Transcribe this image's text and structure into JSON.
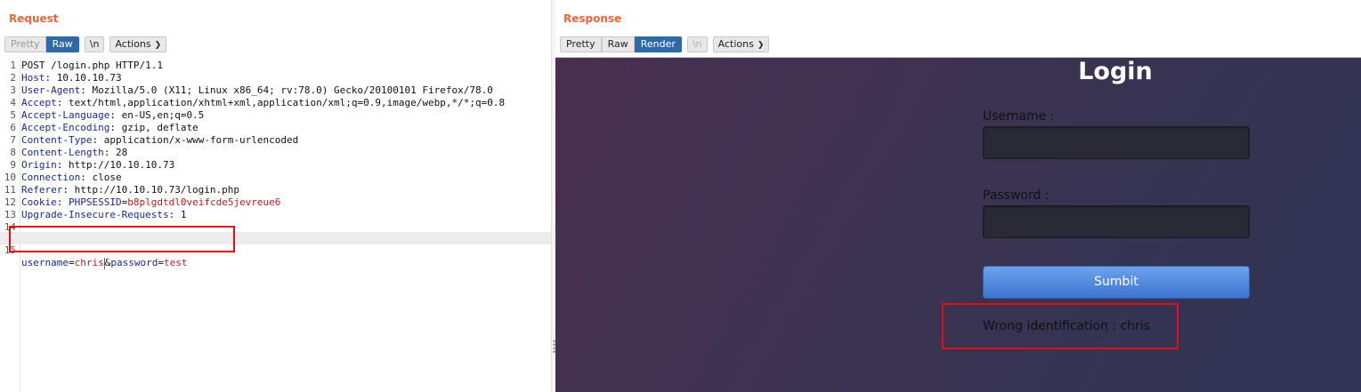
{
  "request": {
    "title": "Request",
    "view_modes": [
      "Pretty",
      "Raw"
    ],
    "newline_label": "\\n",
    "actions_label": "Actions",
    "lines": [
      {
        "n": "1",
        "text": "POST /login.php HTTP/1.1"
      },
      {
        "n": "2",
        "key": "Host",
        "value": " 10.10.10.73"
      },
      {
        "n": "3",
        "key": "User-Agent",
        "value": " Mozilla/5.0 (X11; Linux x86_64; rv:78.0) Gecko/20100101 Firefox/78.0"
      },
      {
        "n": "4",
        "key": "Accept",
        "value": " text/html,application/xhtml+xml,application/xml;q=0.9,image/webp,*/*;q=0.8"
      },
      {
        "n": "5",
        "key": "Accept-Language",
        "value": " en-US,en;q=0.5"
      },
      {
        "n": "6",
        "key": "Accept-Encoding",
        "value": " gzip, deflate"
      },
      {
        "n": "7",
        "key": "Content-Type",
        "value": " application/x-www-form-urlencoded"
      },
      {
        "n": "8",
        "key": "Content-Length",
        "value": " 28"
      },
      {
        "n": "9",
        "key": "Origin",
        "value": " http://10.10.10.73"
      },
      {
        "n": "10",
        "key": "Connection",
        "value": " close"
      },
      {
        "n": "11",
        "key": "Referer",
        "value": " http://10.10.10.73/login.php"
      },
      {
        "n": "12",
        "key": "Cookie",
        "cookie_name": "PHPSESSID",
        "cookie_value": "b8plgdtdl0veifcde5jevreue6"
      },
      {
        "n": "13",
        "key": "Upgrade-Insecure-Requests",
        "value": " 1"
      },
      {
        "n": "14",
        "text": ""
      }
    ],
    "body_line": {
      "n": "15",
      "p1": "username",
      "v1": "chris",
      "p2": "password",
      "v2": "test"
    }
  },
  "response": {
    "title": "Response",
    "view_modes": [
      "Pretty",
      "Raw",
      "Render"
    ],
    "newline_label": "\\n",
    "actions_label": "Actions",
    "page": {
      "heading": "Login",
      "username_label": "Username :",
      "password_label": "Password :",
      "submit_label": "Sumbit",
      "message": "Wrong identification : chris"
    }
  },
  "colors": {
    "accent": "#e8663d",
    "active_tab": "#2f6aa8",
    "highlight": "#e01010"
  }
}
